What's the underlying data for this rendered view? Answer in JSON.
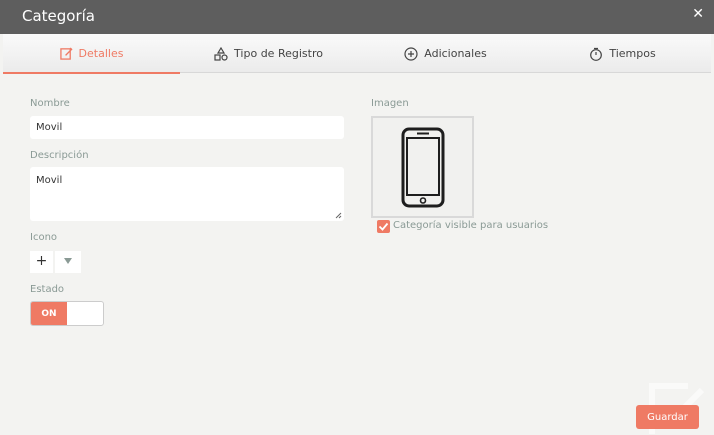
{
  "window": {
    "title": "Categoría"
  },
  "tabs": [
    {
      "label": "Detalles",
      "icon": "edit-icon",
      "active": true
    },
    {
      "label": "Tipo de Registro",
      "icon": "shapes-icon",
      "active": false
    },
    {
      "label": "Adicionales",
      "icon": "plus-circle-icon",
      "active": false
    },
    {
      "label": "Tiempos",
      "icon": "stopwatch-icon",
      "active": false
    }
  ],
  "form": {
    "name_label": "Nombre",
    "name_value": "Movil",
    "description_label": "Descripción",
    "description_value": "Movil",
    "icon_label": "Icono",
    "icon_add": "+",
    "state_label": "Estado",
    "state_toggle": "ON",
    "image_label": "Imagen",
    "image_icon": "smartphone-icon",
    "visible_label": "Categoría visible para usuarios",
    "visible_checked": true
  },
  "actions": {
    "save_label": "Guardar"
  },
  "colors": {
    "accent": "#ef7a64",
    "titlebar": "#5e5e5e",
    "background": "#f3f3f1",
    "label": "#8a9a95"
  }
}
